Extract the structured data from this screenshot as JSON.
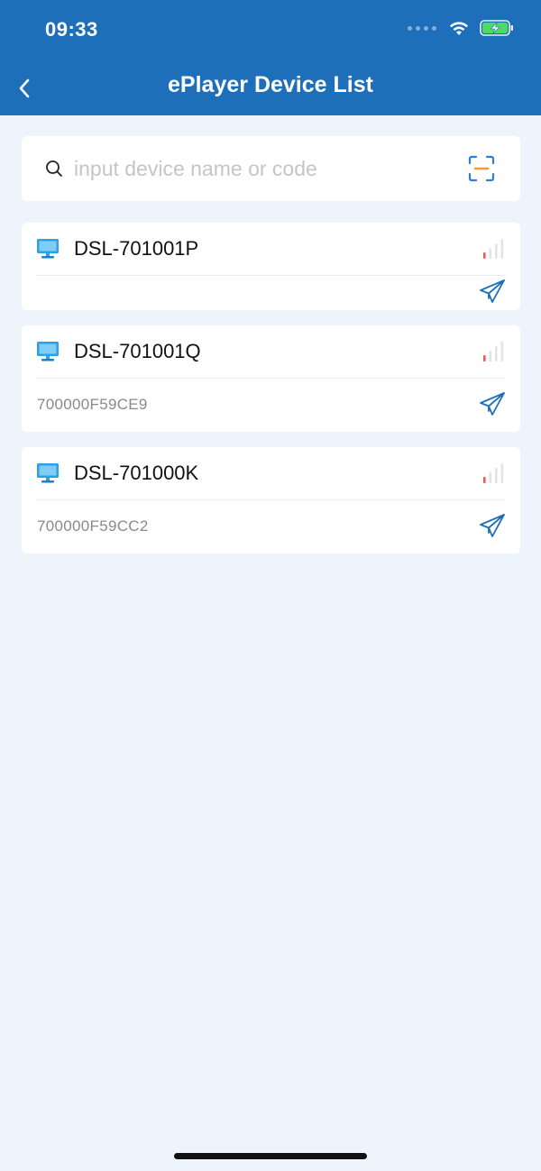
{
  "status_bar": {
    "time": "09:33"
  },
  "nav": {
    "title": "ePlayer Device List",
    "back_icon": "chevron-left-icon"
  },
  "search": {
    "placeholder": "input device name or code",
    "value": "",
    "scan_icon": "scan-icon"
  },
  "devices": [
    {
      "name": "DSL-701001P",
      "code": ""
    },
    {
      "name": "DSL-701001Q",
      "code": "700000F59CE9"
    },
    {
      "name": "DSL-701000K",
      "code": "700000F59CC2"
    }
  ],
  "colors": {
    "header": "#1e6fba",
    "background": "#eef4fb",
    "accent": "#1e6fba",
    "monitor": "#29a3e6",
    "signal_low": "#e85a5a",
    "scan_frame": "#2f7fd1",
    "scan_line": "#f29b30"
  }
}
